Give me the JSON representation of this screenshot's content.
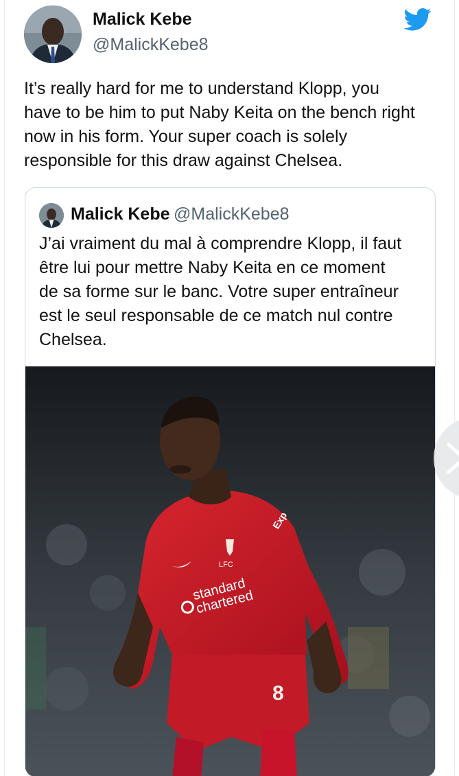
{
  "author": {
    "name": "Malick Kebe",
    "handle": "@MalickKebe8"
  },
  "tweet": {
    "text_lines": [
      "It’s really hard for me to understand Klopp, you",
      "have to be him to put Naby Keita on the bench right",
      "now in his form. Your super coach is solely",
      "responsible for this draw against Chelsea."
    ]
  },
  "quoted_tweet": {
    "name": "Malick Kebe",
    "handle": "@MalickKebe8",
    "text_lines": [
      "J’ai vraiment du mal à comprendre Klopp, il faut",
      "être lui pour mettre Naby Keita en ce moment",
      "de sa forme sur le banc. Votre super entraîneur",
      "est le seul responsable de ce match nul contre",
      "Chelsea."
    ],
    "media": {
      "jersey_sponsor_line1": "standard",
      "jersey_sponsor_line2": "chartered",
      "jersey_club": "LFC",
      "jersey_number": "8",
      "sleeve_text": "Exp"
    }
  },
  "icons": {
    "brand": "twitter-bird-icon",
    "next": "chevron-right-icon"
  },
  "colors": {
    "twitter_blue": "#1d9bf0",
    "handle_grey": "#536471",
    "kit_red": "#c8102e"
  }
}
